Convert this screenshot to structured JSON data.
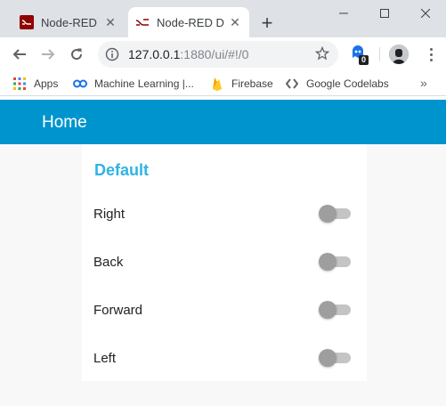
{
  "browser": {
    "tabs": [
      {
        "title": "Node-RED",
        "active": false,
        "icon": "node-red-icon"
      },
      {
        "title": "Node-RED Dashboard",
        "active": true,
        "icon": "node-red-icon"
      }
    ],
    "window_controls": [
      "minimize-icon",
      "maximize-icon",
      "close-icon"
    ],
    "address": {
      "host": "127.0.0.1",
      "rest": ":1880/ui/#!/0"
    },
    "extension_badge": "0",
    "bookmarks": [
      {
        "label": "Apps",
        "icon": "apps-grid-icon"
      },
      {
        "label": "Machine Learning |...",
        "icon": "link-icon"
      },
      {
        "label": "Firebase",
        "icon": "firebase-icon"
      },
      {
        "label": "Google Codelabs",
        "icon": "code-icon"
      }
    ],
    "bookmarks_more": "»"
  },
  "dashboard": {
    "title": "Home",
    "accent": "#0094ce",
    "group": {
      "title": "Default",
      "title_color": "#2fb3e6",
      "switches": [
        {
          "label": "Right",
          "on": false
        },
        {
          "label": "Back",
          "on": false
        },
        {
          "label": "Forward",
          "on": false
        },
        {
          "label": "Left",
          "on": false
        }
      ]
    }
  }
}
